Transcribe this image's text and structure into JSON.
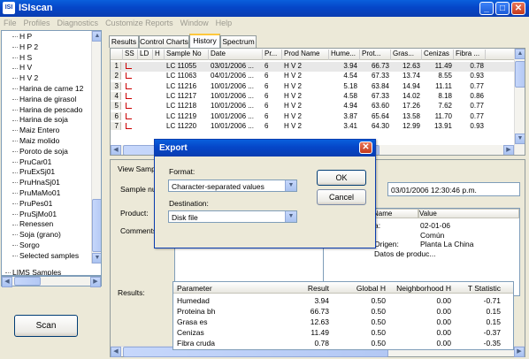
{
  "app": {
    "title": "ISIscan",
    "icon_text": "ISI"
  },
  "menu": [
    "File",
    "Profiles",
    "Diagnostics",
    "Customize Reports",
    "Window",
    "Help"
  ],
  "window_buttons": {
    "minimize": "_",
    "maximize": "□",
    "close": "✕"
  },
  "tree": {
    "items": [
      "H P",
      "H P 2",
      "H S",
      "H V",
      "H V 2",
      "Harina de carne  12",
      "Harina de girasol",
      "Harina de pescado",
      "Harina de soja",
      "Maiz Entero",
      "Maiz molido",
      "Poroto de soja",
      "PruCar01",
      "PruExSj01",
      "PruHnaSj01",
      "PruMaMo01",
      "PruPes01",
      "PruSjMo01",
      "Renessen",
      "Soja (grano)",
      "Sorgo",
      "Selected samples"
    ],
    "root": "LIMS Samples"
  },
  "scan_button": "Scan",
  "tabs": [
    "Results",
    "Control Charts",
    "History",
    "Spectrum"
  ],
  "active_tab": "History",
  "grid": {
    "headers": [
      "",
      "SS",
      "LD",
      "H",
      "Sample No",
      "Date",
      "Pr...",
      "Prod Name",
      "Hume...",
      "Prot...",
      "Gras...",
      "Cenizas",
      "Fibra ..."
    ],
    "rows": [
      [
        "1",
        "LC 11055",
        "03/01/2006 ...",
        "6",
        "H V 2",
        "3.94",
        "66.73",
        "12.63",
        "11.49",
        "0.78"
      ],
      [
        "2",
        "LC 11063",
        "04/01/2006 ...",
        "6",
        "H V 2",
        "4.54",
        "67.33",
        "13.74",
        "8.55",
        "0.93"
      ],
      [
        "3",
        "LC 11216",
        "10/01/2006 ...",
        "6",
        "H V 2",
        "5.18",
        "63.84",
        "14.94",
        "11.11",
        "0.77"
      ],
      [
        "4",
        "LC 11217",
        "10/01/2006 ...",
        "6",
        "H V 2",
        "4.58",
        "67.33",
        "14.02",
        "8.18",
        "0.86"
      ],
      [
        "5",
        "LC 11218",
        "10/01/2006 ...",
        "6",
        "H V 2",
        "4.94",
        "63.60",
        "17.26",
        "7.62",
        "0.77"
      ],
      [
        "6",
        "LC 11219",
        "10/01/2006 ...",
        "6",
        "H V 2",
        "3.87",
        "65.64",
        "13.58",
        "11.70",
        "0.77"
      ],
      [
        "7",
        "LC 11220",
        "10/01/2006 ...",
        "6",
        "H V 2",
        "3.41",
        "64.30",
        "12.99",
        "13.91",
        "0.93"
      ]
    ]
  },
  "sample": {
    "view_label": "View Sample",
    "sample_no_label": "Sample nu",
    "product_label": "Product:",
    "comments_label": "Comments:",
    "datetime": "03/01/2006 12:30:46 p.m.",
    "info_headers": [
      "Name",
      "Value"
    ],
    "info_rows": [
      [
        "a:",
        "02-01-06"
      ],
      [
        "",
        "Común"
      ],
      [
        "Origen:",
        "Planta La China"
      ],
      [
        "Datos de produc...",
        ""
      ]
    ]
  },
  "results": {
    "label": "Results:",
    "headers": [
      "Parameter",
      "Result",
      "Global H",
      "Neighborhood H",
      "T Statistic"
    ],
    "rows": [
      [
        "Humedad",
        "3.94",
        "0.50",
        "0.00",
        "-0.71"
      ],
      [
        "Proteina bh",
        "66.73",
        "0.50",
        "0.00",
        "0.15"
      ],
      [
        "Grasa es",
        "12.63",
        "0.50",
        "0.00",
        "0.15"
      ],
      [
        "Cenizas",
        "11.49",
        "0.50",
        "0.00",
        "-0.37"
      ],
      [
        "Fibra cruda",
        "0.78",
        "0.50",
        "0.00",
        "-0.35"
      ]
    ]
  },
  "dialog": {
    "title": "Export",
    "format_label": "Format:",
    "format_value": "Character-separated values",
    "destination_label": "Destination:",
    "destination_value": "Disk file",
    "ok": "OK",
    "cancel": "Cancel"
  }
}
